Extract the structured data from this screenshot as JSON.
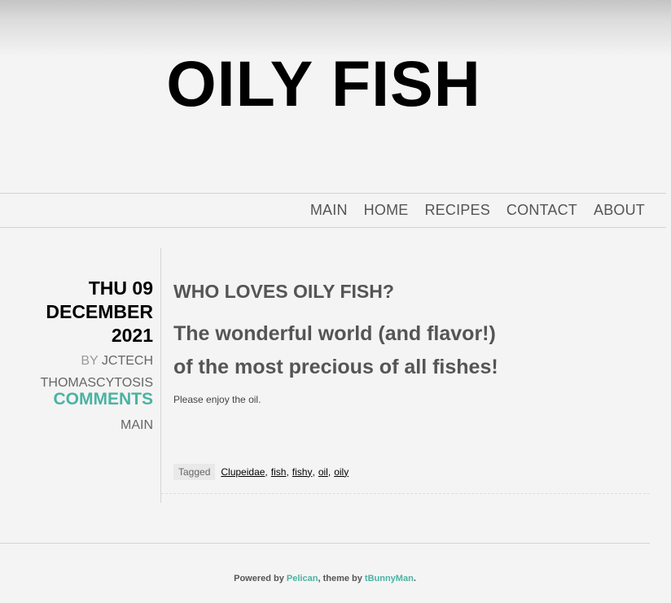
{
  "site": {
    "title": "OILY FISH"
  },
  "nav": {
    "items": [
      "MAIN",
      "HOME",
      "RECIPES",
      "CONTACT",
      "ABOUT"
    ]
  },
  "meta": {
    "date_line1": "THU 09",
    "date_line2": "DECEMBER",
    "date_line3": "2021",
    "by_prefix": "BY",
    "author": "JCTECH",
    "commenter": "THOMASCYTOSIS",
    "comments_label": "COMMENTS",
    "category": "MAIN"
  },
  "article": {
    "title": "WHO LOVES OILY FISH?",
    "subtitle_line1": "The wonderful world (and flavor!)",
    "subtitle_line2": "of the most precious of all fishes!",
    "body": "Please enjoy the oil."
  },
  "tags": {
    "label": "Tagged",
    "items": [
      "Clupeidae",
      "fish",
      "fishy",
      "oil",
      "oily"
    ]
  },
  "footer": {
    "powered_prefix": "Powered by",
    "engine": "Pelican",
    "theme_prefix": ", theme by",
    "theme_author": "tBunnyMan",
    "suffix": "."
  },
  "colors": {
    "accent": "#4bb3a2",
    "background": "#f4f4f4",
    "text": "#555555",
    "title": "#000000"
  }
}
